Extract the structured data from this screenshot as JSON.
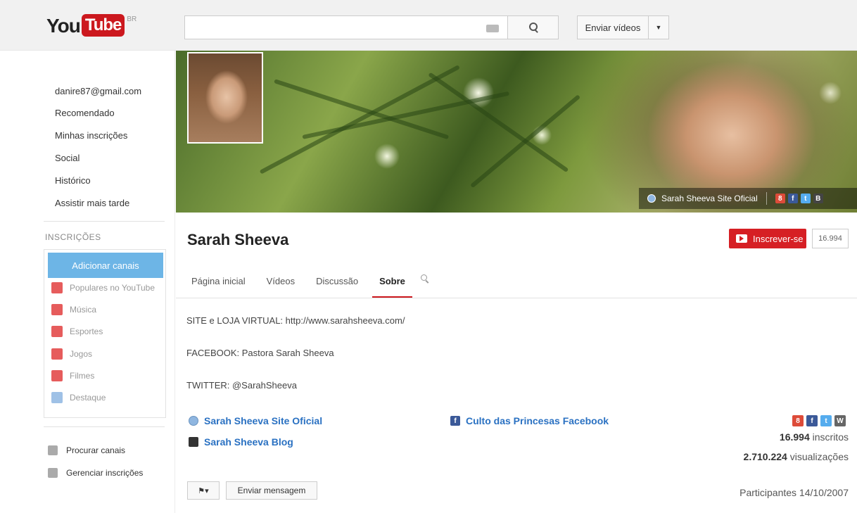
{
  "header": {
    "logo_you": "You",
    "logo_tube": "Tube",
    "region": "BR",
    "search_placeholder": "",
    "upload_label": "Enviar vídeos"
  },
  "sidebar": {
    "account": "danire87@gmail.com",
    "items": [
      "Recomendado",
      "Minhas inscrições",
      "Social",
      "Histórico",
      "Assistir mais tarde"
    ],
    "subscriptions_header": "INSCRIÇÕES",
    "add_channels": "Adicionar canais",
    "categories": [
      "Populares no YouTube",
      "Música",
      "Esportes",
      "Jogos",
      "Filmes",
      "Destaque"
    ],
    "browse_channels": "Procurar canais",
    "manage_subscriptions": "Gerenciar inscrições"
  },
  "banner": {
    "site_link": "Sarah Sheeva Site Oficial",
    "social_icons": [
      "google-plus-icon",
      "facebook-icon",
      "twitter-icon",
      "blogger-icon"
    ]
  },
  "channel": {
    "name": "Sarah Sheeva",
    "subscribe_label": "Inscrever-se",
    "subscriber_count": "16.994",
    "tabs": [
      "Página inicial",
      "Vídeos",
      "Discussão",
      "Sobre"
    ],
    "active_tab": "Sobre"
  },
  "about": {
    "lines": [
      "SITE e LOJA VIRTUAL: http://www.sarahsheeva.com/",
      "FACEBOOK: Pastora Sarah Sheeva",
      "TWITTER: @SarahSheeva"
    ],
    "links": [
      "Sarah Sheeva Site Oficial",
      "Sarah Sheeva Blog",
      "Culto das Princesas Facebook"
    ],
    "subscribers_value": "16.994",
    "subscribers_label": "inscritos",
    "views_value": "2.710.224",
    "views_label": "visualizações",
    "joined": "Participantes 14/10/2007",
    "send_message": "Enviar mensagem"
  },
  "colors": {
    "brand_red": "#cc181e",
    "link_blue": "#2a71c2",
    "add_channels_blue": "#6db5e6"
  }
}
